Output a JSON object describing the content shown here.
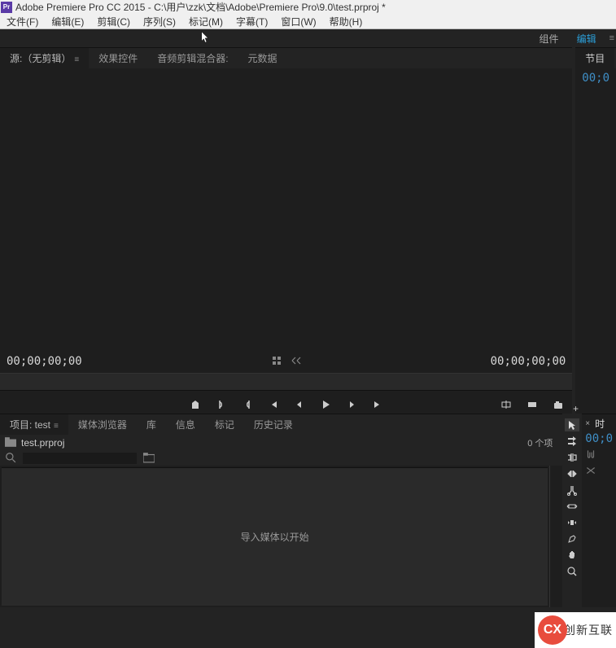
{
  "titlebar": {
    "icon_text": "Pr",
    "title": "Adobe Premiere Pro CC 2015 - C:\\用户\\zzk\\文档\\Adobe\\Premiere Pro\\9.0\\test.prproj *"
  },
  "menubar": {
    "items": [
      "文件(F)",
      "编辑(E)",
      "剪辑(C)",
      "序列(S)",
      "标记(M)",
      "字幕(T)",
      "窗口(W)",
      "帮助(H)"
    ]
  },
  "workspace": {
    "items": [
      {
        "label": "组件",
        "active": false
      },
      {
        "label": "编辑",
        "active": true
      }
    ]
  },
  "source": {
    "tabs": [
      {
        "label": "源:（无剪辑）",
        "active": true,
        "eq": true
      },
      {
        "label": "效果控件",
        "active": false
      },
      {
        "label": "音频剪辑混合器:",
        "active": false
      },
      {
        "label": "元数据",
        "active": false
      }
    ],
    "tc_left": "00;00;00;00",
    "tc_right": "00;00;00;00"
  },
  "program": {
    "tab": "节目",
    "tc_left": "00;0"
  },
  "project": {
    "tabs": [
      {
        "label": "项目: test",
        "active": true,
        "eq": true
      },
      {
        "label": "媒体浏览器",
        "active": false
      },
      {
        "label": "库",
        "active": false
      },
      {
        "label": "信息",
        "active": false
      },
      {
        "label": "标记",
        "active": false
      },
      {
        "label": "历史记录",
        "active": false
      }
    ],
    "filename": "test.prproj",
    "item_count": "0 个项",
    "search_placeholder": "",
    "import_hint": "导入媒体以开始"
  },
  "timeline": {
    "tab": "时",
    "tc": "00;0"
  },
  "watermark": {
    "logo": "CX",
    "text": "创新互联"
  }
}
